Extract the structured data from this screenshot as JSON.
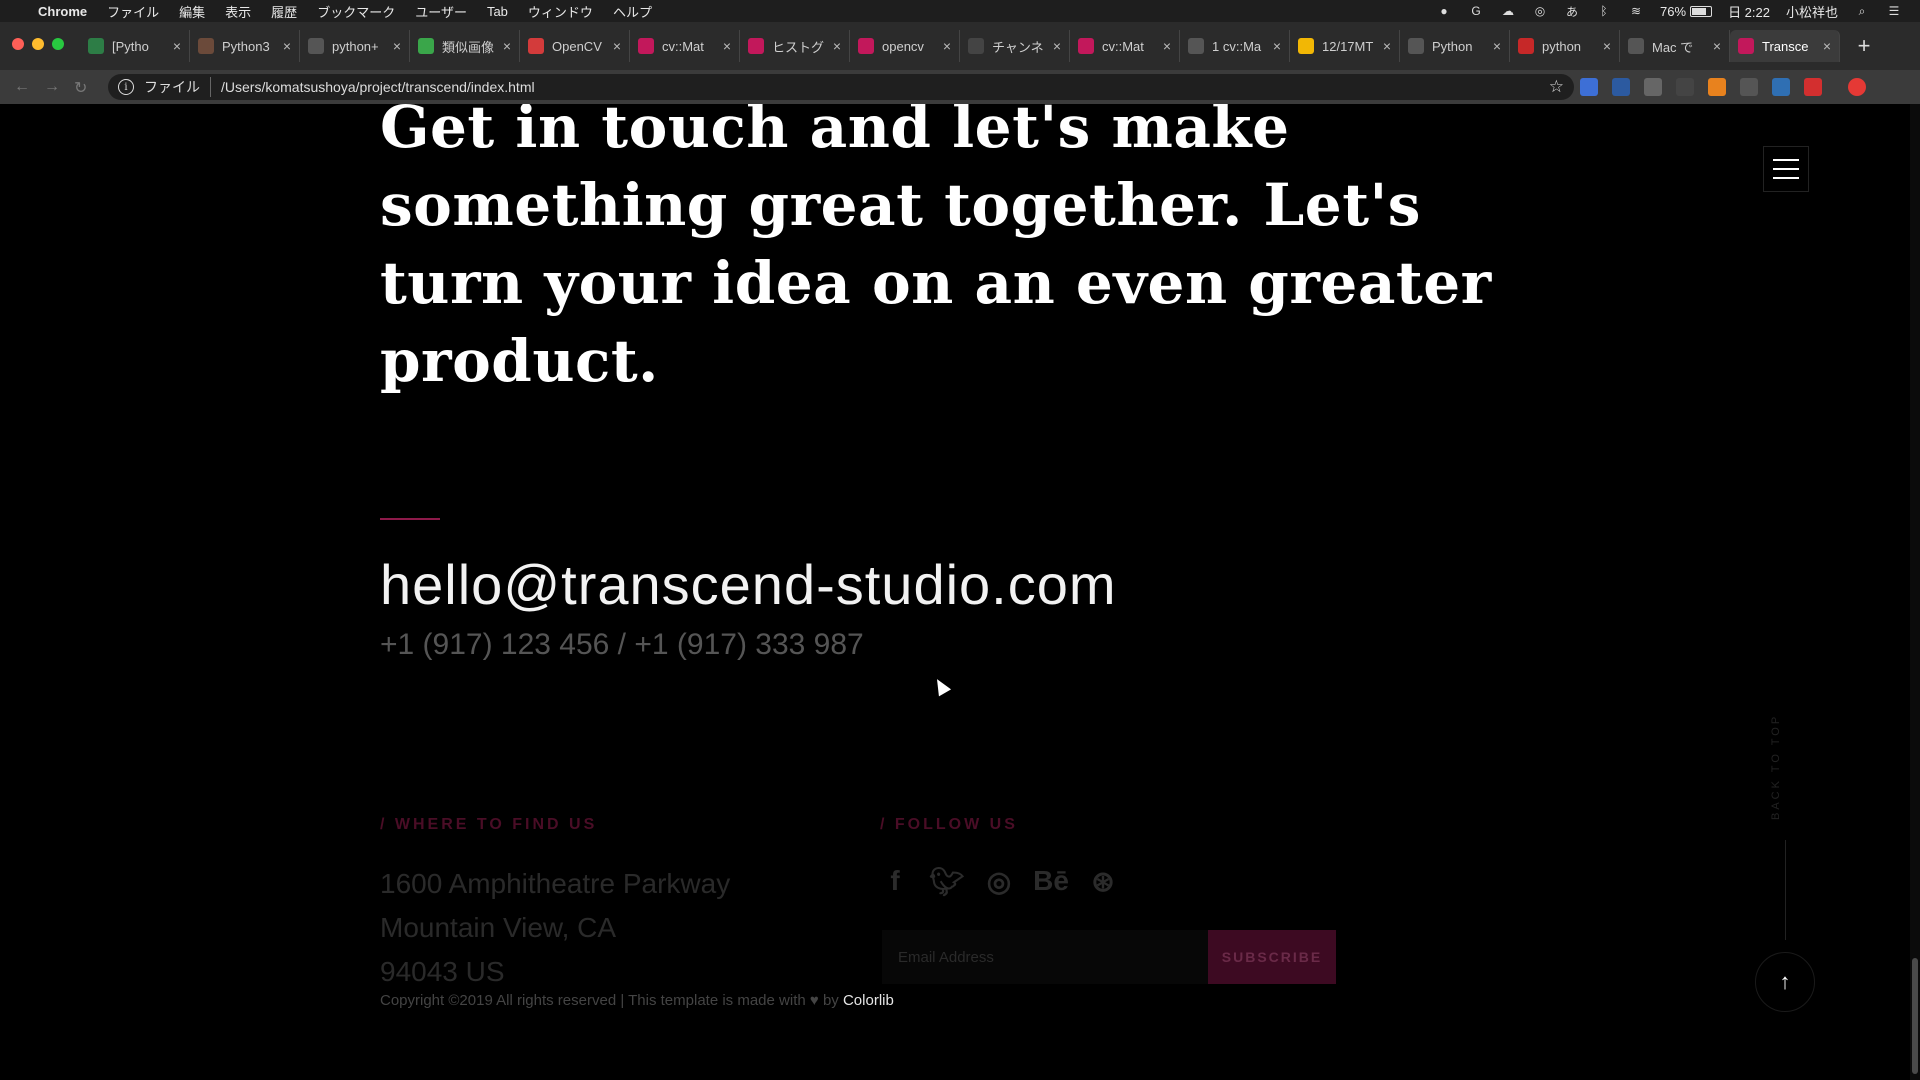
{
  "menubar": {
    "apple": "",
    "app": "Chrome",
    "items": [
      "ファイル",
      "編集",
      "表示",
      "履歴",
      "ブックマーク",
      "ユーザー",
      "Tab",
      "ウィンドウ",
      "ヘルプ"
    ],
    "battery": "76%",
    "time": "日 2:22",
    "user": "小松祥也"
  },
  "tabs": [
    {
      "title": "[Pytho",
      "color": "#2d7d46"
    },
    {
      "title": "Python3",
      "color": "#6b4a3a"
    },
    {
      "title": "python+",
      "color": "#555555"
    },
    {
      "title": "類似画像",
      "color": "#3aa64a"
    },
    {
      "title": "OpenCV",
      "color": "#d33b3b"
    },
    {
      "title": "cv::Mat",
      "color": "#c2185b"
    },
    {
      "title": "ヒストグ",
      "color": "#c2185b"
    },
    {
      "title": "opencv",
      "color": "#c2185b"
    },
    {
      "title": "チャンネ",
      "color": "#444444"
    },
    {
      "title": "cv::Mat",
      "color": "#c2185b"
    },
    {
      "title": "1 cv::Ma",
      "color": "#555555"
    },
    {
      "title": "12/17MT",
      "color": "#f2b705"
    },
    {
      "title": "Python",
      "color": "#555555"
    },
    {
      "title": "python",
      "color": "#c62828"
    },
    {
      "title": "Mac で",
      "color": "#555555"
    },
    {
      "title": "Transce",
      "color": "#c2185b",
      "active": true
    }
  ],
  "omnibox": {
    "scheme": "ファイル",
    "url": "/Users/komatsushoya/project/transcend/index.html"
  },
  "page": {
    "headline": "Get in touch and let's make something great together. Let's turn your idea on an even greater product.",
    "email": "hello@transcend-studio.com",
    "phones": "+1 (917) 123 456 / +1 (917) 333 987",
    "where_title": "/ WHERE TO FIND US",
    "address": [
      "1600 Amphitheatre Parkway",
      "Mountain View, CA",
      "94043 US"
    ],
    "follow_title": "/ FOLLOW US",
    "social": [
      "facebook-icon",
      "twitter-icon",
      "instagram-icon",
      "behance-icon",
      "dribbble-icon"
    ],
    "email_placeholder": "Email Address",
    "subscribe": "SUBSCRIBE",
    "copyright_pre": "Copyright ©2019 All rights reserved | This template is made with",
    "copyright_by": "by",
    "copyright_brand": "Colorlib",
    "back_to_top": "BACK TO TOP"
  }
}
